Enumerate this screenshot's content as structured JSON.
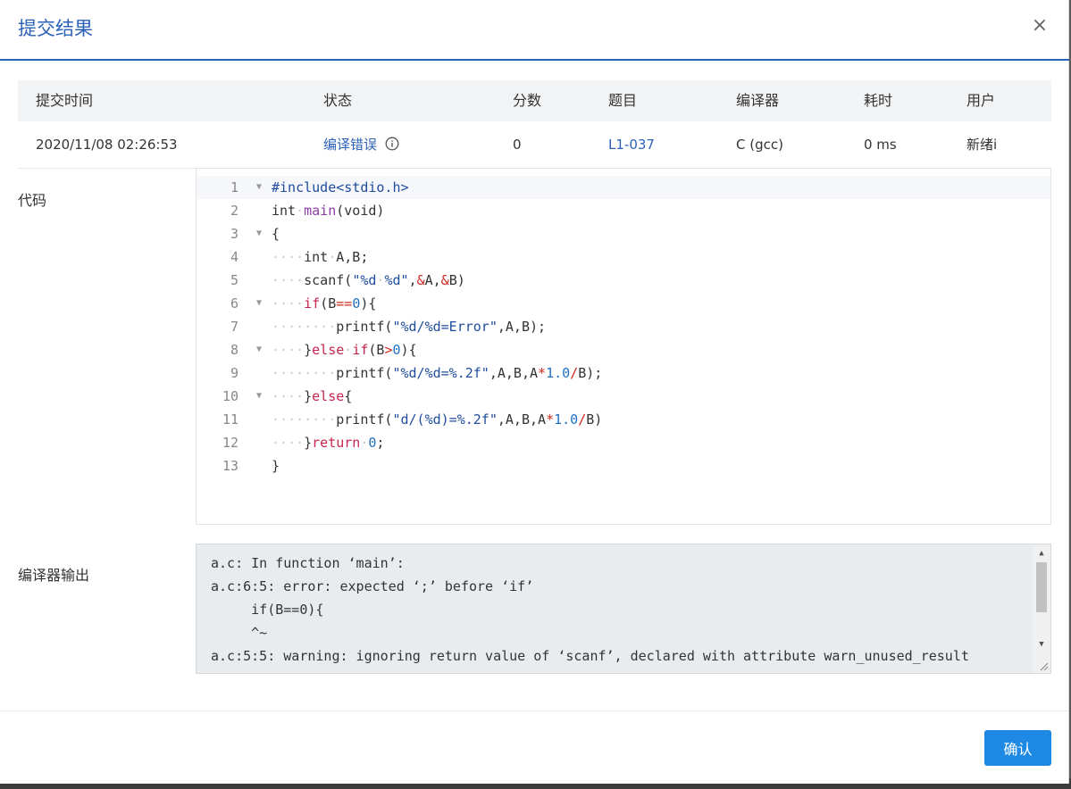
{
  "dialog": {
    "title": "提交结果",
    "close_glyph": "×",
    "confirm_label": "确认"
  },
  "table": {
    "headers": [
      "提交时间",
      "状态",
      "分数",
      "题目",
      "编译器",
      "耗时",
      "用户"
    ],
    "row": {
      "time": "2020/11/08 02:26:53",
      "status": "编译错误",
      "score": "0",
      "problem": "L1-037",
      "compiler": "C (gcc)",
      "elapsed": "0 ms",
      "user": "新绪i"
    }
  },
  "code_label": "代码",
  "output_label": "编译器输出",
  "code_lines": [
    {
      "n": "1",
      "fold": true
    },
    {
      "n": "2",
      "fold": false
    },
    {
      "n": "3",
      "fold": true
    },
    {
      "n": "4",
      "fold": false
    },
    {
      "n": "5",
      "fold": false
    },
    {
      "n": "6",
      "fold": true
    },
    {
      "n": "7",
      "fold": false
    },
    {
      "n": "8",
      "fold": true
    },
    {
      "n": "9",
      "fold": false
    },
    {
      "n": "10",
      "fold": true
    },
    {
      "n": "11",
      "fold": false
    },
    {
      "n": "12",
      "fold": false
    },
    {
      "n": "13",
      "fold": false
    }
  ],
  "compiler_output": [
    "a.c: In function ‘main’:",
    "a.c:6:5: error: expected ‘;’ before ‘if’",
    "     if(B==0){",
    "     ^~",
    "a.c:5:5: warning: ignoring return value of ‘scanf’, declared with attribute warn_unused_result"
  ],
  "icons": {
    "close": "close-icon",
    "info": "info-icon",
    "fold": "fold-arrow-icon"
  },
  "colors": {
    "accent": "#2c62b8",
    "button": "#1e88e5"
  }
}
